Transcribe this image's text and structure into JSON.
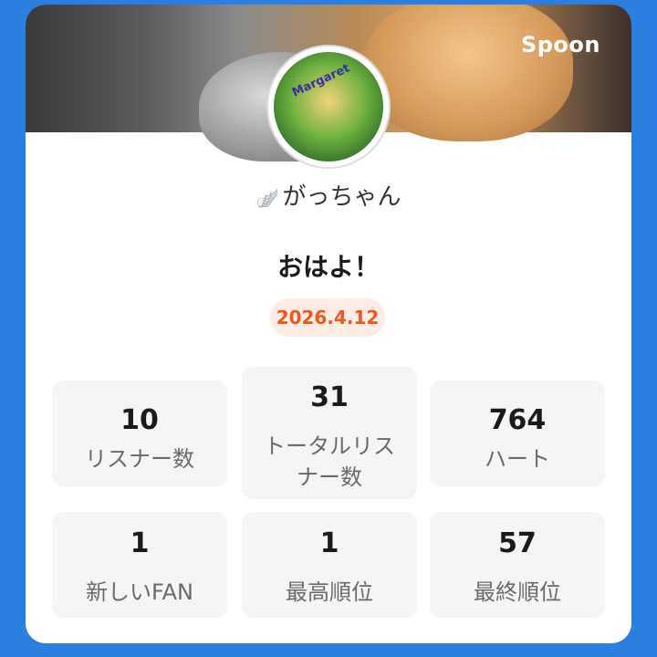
{
  "brand": "Spoon",
  "profile": {
    "name": "がっちゃん",
    "avatar_text": "Margaret"
  },
  "title": "おはよ！",
  "date": "2026.4.12",
  "stats": [
    {
      "value": "10",
      "label": "リスナー数"
    },
    {
      "value": "31",
      "label": "トータルリスナー数"
    },
    {
      "value": "764",
      "label": "ハート"
    },
    {
      "value": "1",
      "label": "新しいFAN"
    },
    {
      "value": "1",
      "label": "最高順位"
    },
    {
      "value": "57",
      "label": "最終順位"
    }
  ],
  "colors": {
    "background": "#2a7fe0",
    "date_text": "#f0561f",
    "date_badge": "#fdece4"
  }
}
